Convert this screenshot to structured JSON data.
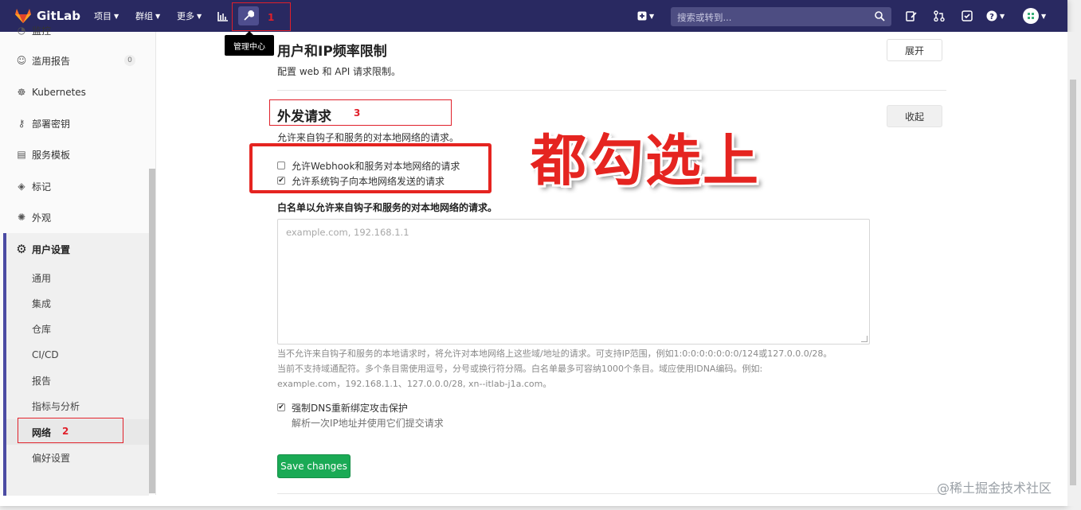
{
  "nav": {
    "brand": "GitLab",
    "projects": "项目",
    "groups": "群组",
    "more": "更多",
    "search_placeholder": "搜索或转到...",
    "admin_tooltip": "管理中心",
    "colors": {
      "bar": "#292961",
      "accent": "#fc6d26"
    }
  },
  "annotations": {
    "num1": "1",
    "num2": "2",
    "num3": "3",
    "callout": "都勾选上",
    "watermark": "@稀土掘金技术社区"
  },
  "sidebar": {
    "items": [
      {
        "label": "监控",
        "icon": "monitor-icon"
      },
      {
        "label": "滥用报告",
        "icon": "smiley-icon",
        "badge": "0"
      },
      {
        "label": "Kubernetes",
        "icon": "kubernetes-icon"
      },
      {
        "label": "部署密钥",
        "icon": "key-icon"
      },
      {
        "label": "服务模板",
        "icon": "template-icon"
      },
      {
        "label": "标记",
        "icon": "label-icon"
      },
      {
        "label": "外观",
        "icon": "palette-icon"
      }
    ],
    "settings_label": "用户设置",
    "sub_items": [
      "通用",
      "集成",
      "仓库",
      "CI/CD",
      "报告",
      "指标与分析",
      "网络",
      "偏好设置"
    ]
  },
  "main": {
    "rate_limit": {
      "title": "用户和IP频率限制",
      "desc": "配置 web 和 API 请求限制。",
      "expand_label": "展开"
    },
    "outbound": {
      "title": "外发请求",
      "desc": "允许来自钩子和服务的对本地网络的请求。",
      "collapse_label": "收起",
      "opt_webhook": "允许Webhook和服务对本地网络的请求",
      "opt_webhook_checked": false,
      "opt_system_hooks": "允许系统钩子向本地网络发送的请求",
      "opt_system_hooks_checked": true,
      "whitelist_label": "白名单以允许来自钩子和服务的对本地网络的请求。",
      "whitelist_placeholder": "example.com, 192.168.1.1",
      "help_line1": "当不允许来自钩子和服务的本地请求时，将允许对本地网络上这些域/地址的请求。可支持IP范围，例如1:0:0:0:0:0:0:0/124或127.0.0.0/28。",
      "help_line2": "当前不支持域通配符。多个条目需使用逗号，分号或换行符分隔。白名单最多可容纳1000个条目。域应使用IDNA编码。例如:",
      "help_line3": "example.com，192.168.1.1、127.0.0.0/28, xn--itlab-j1a.com。",
      "dns_label": "强制DNS重新绑定攻击保护",
      "dns_checked": true,
      "dns_help": "解析一次IP地址并使用它们提交请求",
      "save_label": "Save changes"
    }
  }
}
